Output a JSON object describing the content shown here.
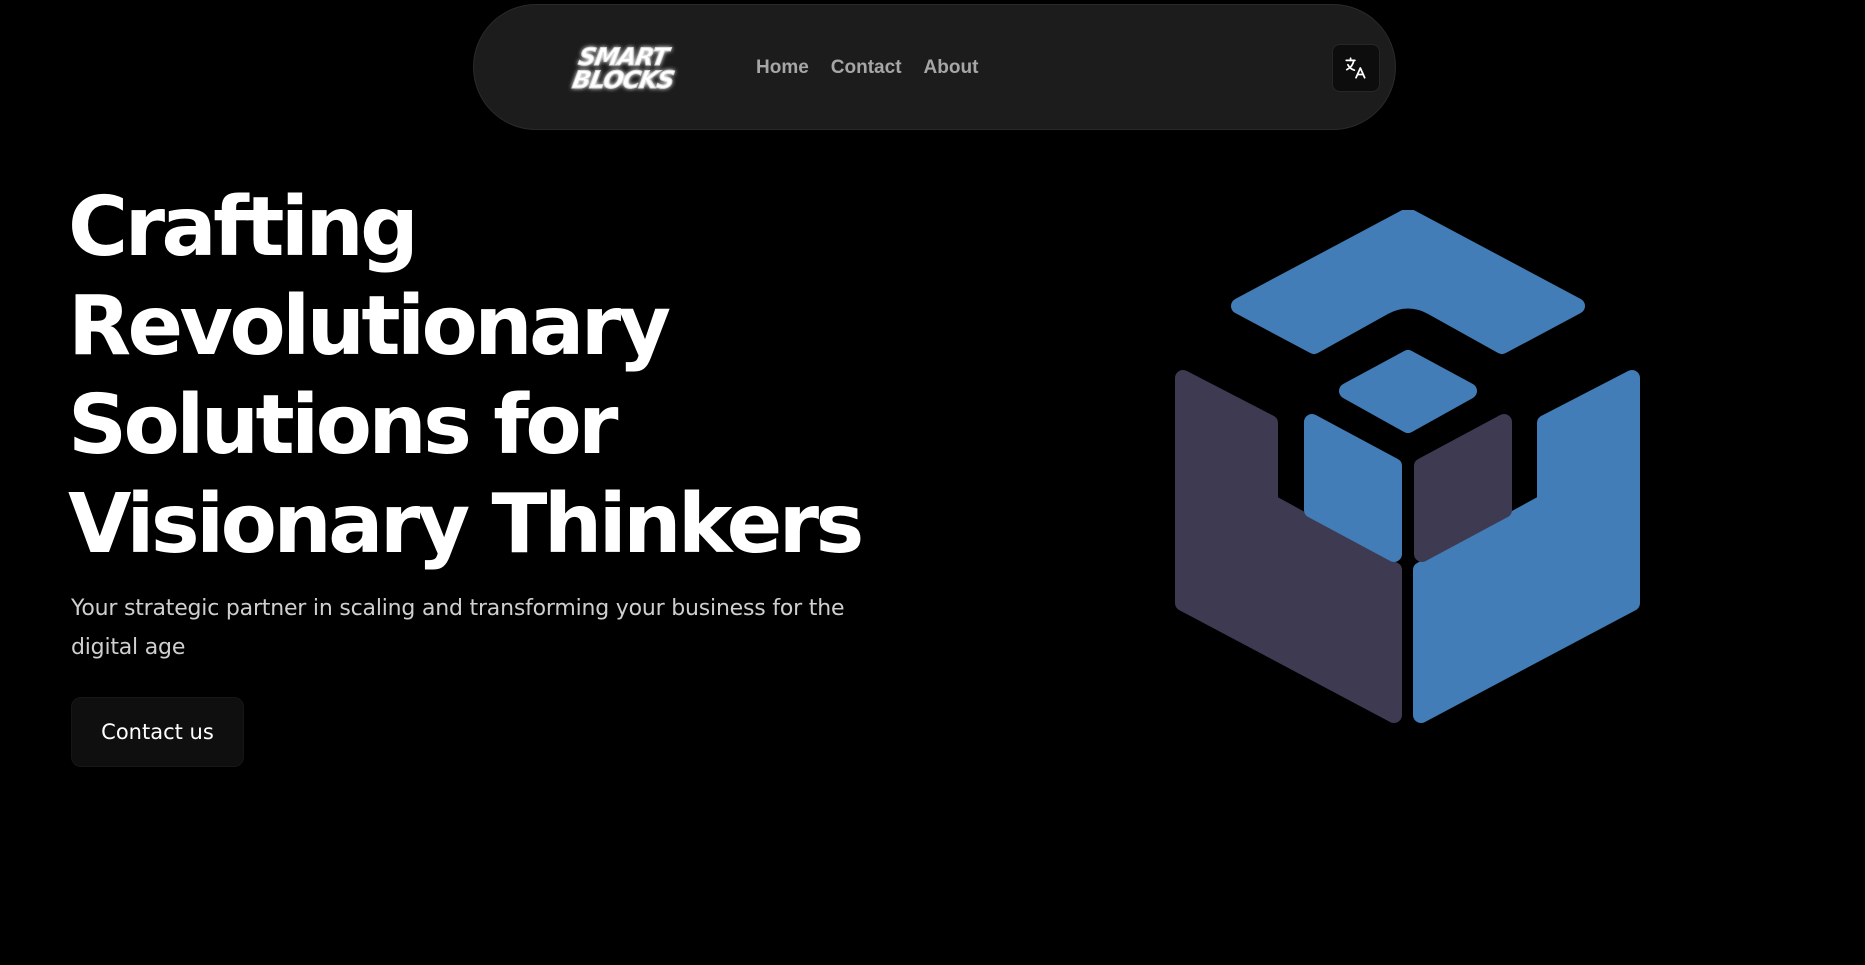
{
  "navbar": {
    "logo": {
      "line1": "SMART",
      "line2": "BLOCKS"
    },
    "links": [
      {
        "label": "Home"
      },
      {
        "label": "Contact"
      },
      {
        "label": "About"
      }
    ],
    "translate_icon": "translate-icon"
  },
  "hero": {
    "title_lines": [
      "Crafting",
      "Revolutionary",
      "Solutions for",
      "Visionary Thinkers"
    ],
    "subtitle": "Your strategic partner in scaling and transforming your business for the digital age",
    "cta_label": "Contact us"
  },
  "illustration": {
    "icon": "cube-logo-icon"
  },
  "colors": {
    "background": "#000000",
    "navbar": "#1c1c1c",
    "cube_blue": "#427db7",
    "cube_purple": "#3d3a52",
    "text_primary": "#ffffff",
    "text_secondary": "#cfcfcf",
    "nav_text": "#a6a6a6"
  }
}
